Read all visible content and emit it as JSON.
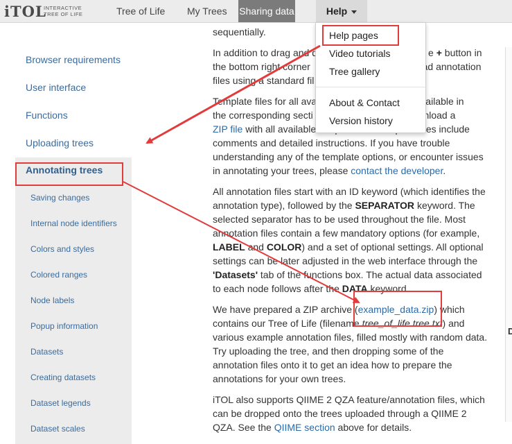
{
  "brand": {
    "logo": "iTOL",
    "tagline_1": "INTERACTIVE",
    "tagline_2": "TREE OF LIFE"
  },
  "nav": {
    "tree_of_life": "Tree of Life",
    "my_trees": "My Trees",
    "sharing_data": "Sharing data",
    "help": "Help"
  },
  "help_menu": {
    "items": [
      "Help pages",
      "Video tutorials",
      "Tree gallery",
      "About & Contact",
      "Version history"
    ]
  },
  "sidebar": {
    "items": [
      "Browser requirements",
      "User interface",
      "Functions",
      "Uploading trees"
    ],
    "active": "Annotating trees",
    "sub_items": [
      "Saving changes",
      "Internal node identifiers",
      "Colors and styles",
      "Colored ranges",
      "Node labels",
      "Popup information",
      "Datasets",
      "Creating datasets",
      "Dataset legends",
      "Dataset scales"
    ]
  },
  "content": {
    "p0": "sequentially.",
    "p1_a": "In addition to drag and d",
    "p1_b": "e",
    "p1_plus": "+",
    "p1_c": "button in",
    "p1_d": "the bottom right corner",
    "p1_e": "oad annotation",
    "p1_f": "files using a standard fil",
    "p2_a": "Template files for all ava",
    "p2_b": "re available in",
    "p2_c": "the corresponding secti",
    "p2_d": "download a",
    "p2_link": "ZIP file",
    "p2_e": "with all available templates. All template files include comments and detailed instructions. If you have trouble understanding any of the template options, or encounter issues in annotating your trees, please",
    "p2_link2": "contact the developer",
    "p2_f": ".",
    "p3_a": "All annotation files start with an ID keyword (which identifies the annotation type), followed by the",
    "p3_sep": "SEPARATOR",
    "p3_b": "keyword. The selected separator has to be used throughout the file. Most annotation files contain a few mandatory options (for example,",
    "p3_label": "LABEL",
    "p3_c": "and",
    "p3_color": "COLOR",
    "p3_d": ") and a set of optional settings. All optional settings can be later adjusted in the web interface through the",
    "p3_ds": "'Datasets'",
    "p3_e": "tab of the functions box. The actual data associated to each node follows after the",
    "p3_data": "DATA",
    "p3_f": "keyword.",
    "p4_a": "We have prepared a ZIP archive (",
    "p4_link": "example_data.zip",
    "p4_b": ") which contains our Tree of Life (filename",
    "p4_file": "tree_of_life.tree.txt",
    "p4_c": ") and various example annotation files, filled mostly with random data. Try uploading the tree, and then dropping some of the annotation files onto it to get an idea how to prepare the annotations for your own trees.",
    "p5_a": "iTOL also supports QIIME 2 QZA feature/annotation files, which can be dropped onto the trees uploaded through a QIIME 2 QZA. See the",
    "p5_link": "QIIME section",
    "p5_b": "above for details."
  },
  "right_fragment": "D",
  "colors": {
    "annotation_red": "#e23b3b",
    "link_blue": "#2a6aa8",
    "nav_active": "#7b7b7b"
  }
}
